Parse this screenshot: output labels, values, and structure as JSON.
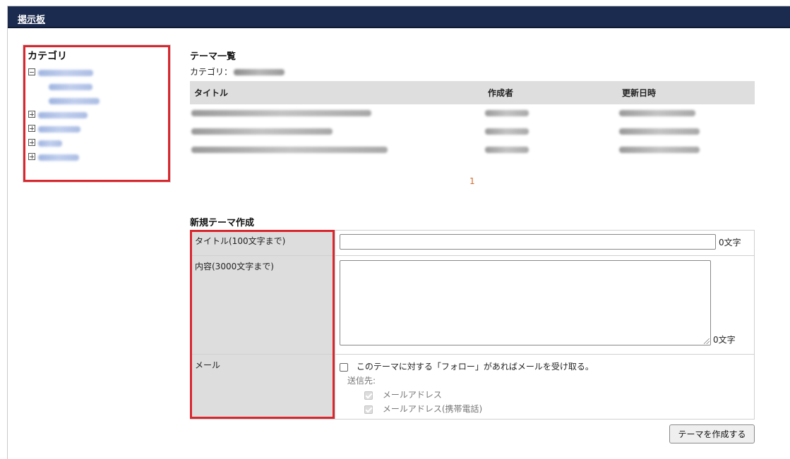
{
  "header": {
    "title": "掲示板"
  },
  "sidebar": {
    "title": "カテゴリ",
    "items": [
      {
        "toggle": "minus",
        "level": 0,
        "label_width": 78
      },
      {
        "toggle": "none",
        "level": 1,
        "label_width": 62
      },
      {
        "toggle": "none",
        "level": 1,
        "label_width": 72
      },
      {
        "toggle": "plus",
        "level": 0,
        "label_width": 70
      },
      {
        "toggle": "plus",
        "level": 0,
        "label_width": 60
      },
      {
        "toggle": "plus",
        "level": 0,
        "label_width": 34
      },
      {
        "toggle": "plus",
        "level": 0,
        "label_width": 58
      }
    ]
  },
  "theme_list": {
    "title": "テーマ一覧",
    "category_label": "カテゴリ：",
    "columns": [
      "タイトル",
      "作成者",
      "更新日時"
    ],
    "rows": [
      {
        "title_w": 255,
        "author_w": 62,
        "date_w": 108
      },
      {
        "title_w": 200,
        "author_w": 62,
        "date_w": 114
      },
      {
        "title_w": 278,
        "author_w": 62,
        "date_w": 114
      }
    ],
    "pager": "1"
  },
  "new_theme": {
    "title": "新規テーマ作成",
    "title_label": "タイトル(100文字まで)",
    "title_value": "",
    "title_count": "0文字",
    "content_label": "内容(3000文字まで)",
    "content_value": "",
    "content_count": "0文字",
    "mail_label": "メール",
    "follow_text": "このテーマに対する「フォロー」があればメールを受け取る。",
    "send_to_label": "送信先:",
    "send_options": [
      "メールアドレス",
      "メールアドレス(携帯電話)"
    ],
    "submit_label": "テーマを作成する"
  },
  "colors": {
    "header_bg": "#1b2b4f",
    "highlight": "#d9272e",
    "pager": "#d06a2a"
  }
}
